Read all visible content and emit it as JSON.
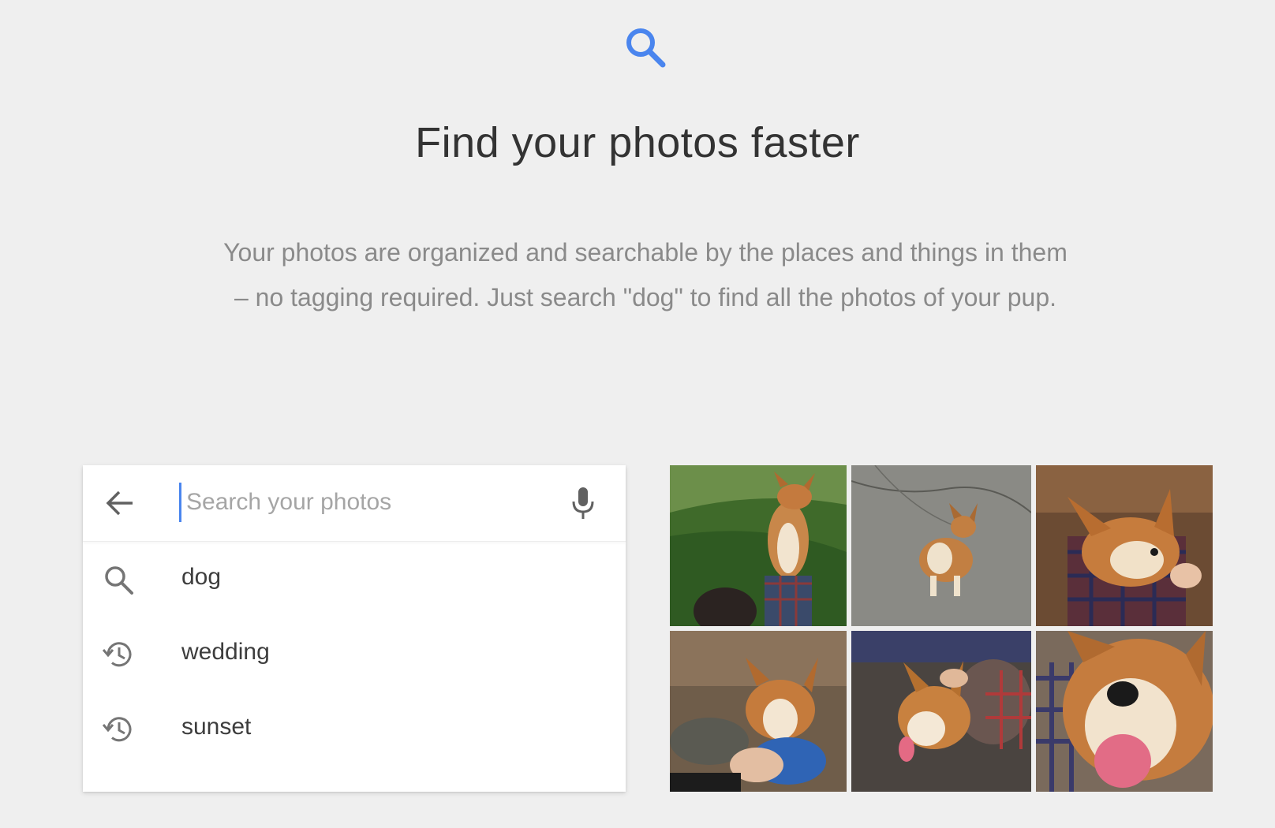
{
  "hero": {
    "icon": "search-icon",
    "accent_color": "#4a85ee",
    "title": "Find your photos faster",
    "description": "Your photos are organized and searchable by the places and things in them – no tagging required. Just search \"dog\" to find all the photos of your pup."
  },
  "search": {
    "back_icon": "arrow-back-icon",
    "placeholder": "Search your photos",
    "value": "",
    "mic_icon": "microphone-icon",
    "suggestions": [
      {
        "icon": "search-icon",
        "label": "dog"
      },
      {
        "icon": "history-icon",
        "label": "wedding"
      },
      {
        "icon": "history-icon",
        "label": "sunset"
      }
    ]
  },
  "photos": [
    {
      "subject": "corgi-standing-on-grass-with-person"
    },
    {
      "subject": "corgi-on-leash-on-pavement"
    },
    {
      "subject": "corgi-held-by-person-in-plaid"
    },
    {
      "subject": "corgi-with-blue-toy"
    },
    {
      "subject": "corgi-being-petted-tongue-out"
    },
    {
      "subject": "corgi-closeup-tongue-out"
    }
  ]
}
